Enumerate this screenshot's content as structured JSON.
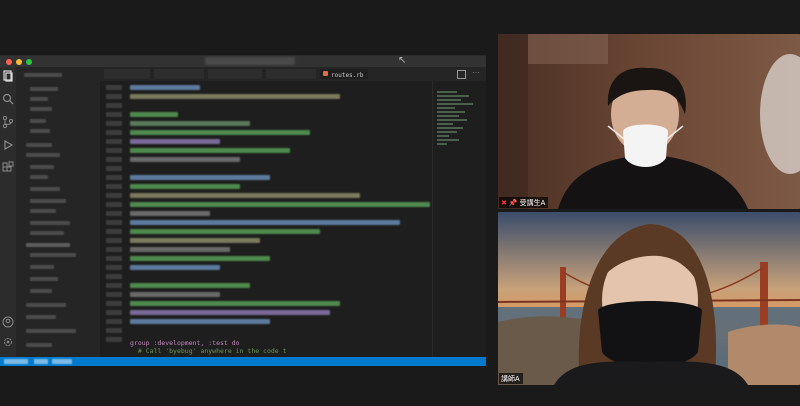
{
  "shared_screen": {
    "tab_active_label": "routes.rb",
    "code_snippet": [
      "group :development, :test do",
      "  # Call 'byebug' anywhere in the code t"
    ],
    "line_numbers": [
      "33",
      "34",
      "35",
      "36",
      "37",
      "38",
      "39",
      "40",
      "41",
      "42",
      "43",
      "44",
      "45",
      "46",
      "47",
      "48",
      "49",
      "50",
      "51",
      "52",
      "53",
      "54",
      "55",
      "56",
      "57",
      "58",
      "59",
      "60",
      "61",
      "62",
      "63",
      "64",
      "65",
      "66"
    ]
  },
  "participants": [
    {
      "name": "受講生A",
      "muted_icon": "mic-off-icon",
      "pinned_icon": "pin-icon",
      "colors": {
        "bg": "#5a3b2c",
        "mask": "#ffffff"
      }
    },
    {
      "name": "講師A",
      "colors": {
        "bg": "#2b2b30",
        "mask": "#121214"
      }
    }
  ],
  "colors": {
    "status_bar": "#007acc",
    "editor_bg": "#1e1e1e",
    "page_bg": "#1a1a1a"
  }
}
